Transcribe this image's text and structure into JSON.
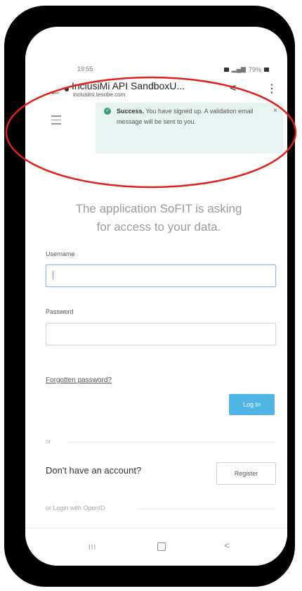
{
  "status_bar": {
    "time": "19:55",
    "battery": "79%"
  },
  "browser": {
    "back_glyph": "←",
    "page_title": "InclusiMi API SandboxU...",
    "page_url": "inclusimi.tesobe.com",
    "share_glyph": "<",
    "menu_glyph": "⋮"
  },
  "alert": {
    "status_word": "Success.",
    "message": " You have signed up. A validation email message will be sent to you.",
    "close_glyph": "×",
    "check_glyph": "✓"
  },
  "heading": {
    "line1": "The application SoFIT is asking",
    "line2": "for access to your data."
  },
  "form": {
    "username_label": "Username",
    "username_value": "",
    "password_label": "Password",
    "password_value": "",
    "forgot_link": "Forgotten password?",
    "login_button": "Log In"
  },
  "divider_or": "or",
  "signup": {
    "prompt": "Don't have an account?",
    "register_button": "Register"
  },
  "openid_text": "or Login with OpenID",
  "nav": {
    "recents_glyph": "III",
    "back_glyph": "<"
  },
  "annotation": {
    "color": "#e0201b"
  },
  "icons": [
    "back-arrow-icon",
    "share-icon",
    "overflow-menu-icon",
    "hamburger-icon",
    "success-check-icon",
    "close-icon",
    "home-icon",
    "recents-icon",
    "nav-back-icon"
  ]
}
